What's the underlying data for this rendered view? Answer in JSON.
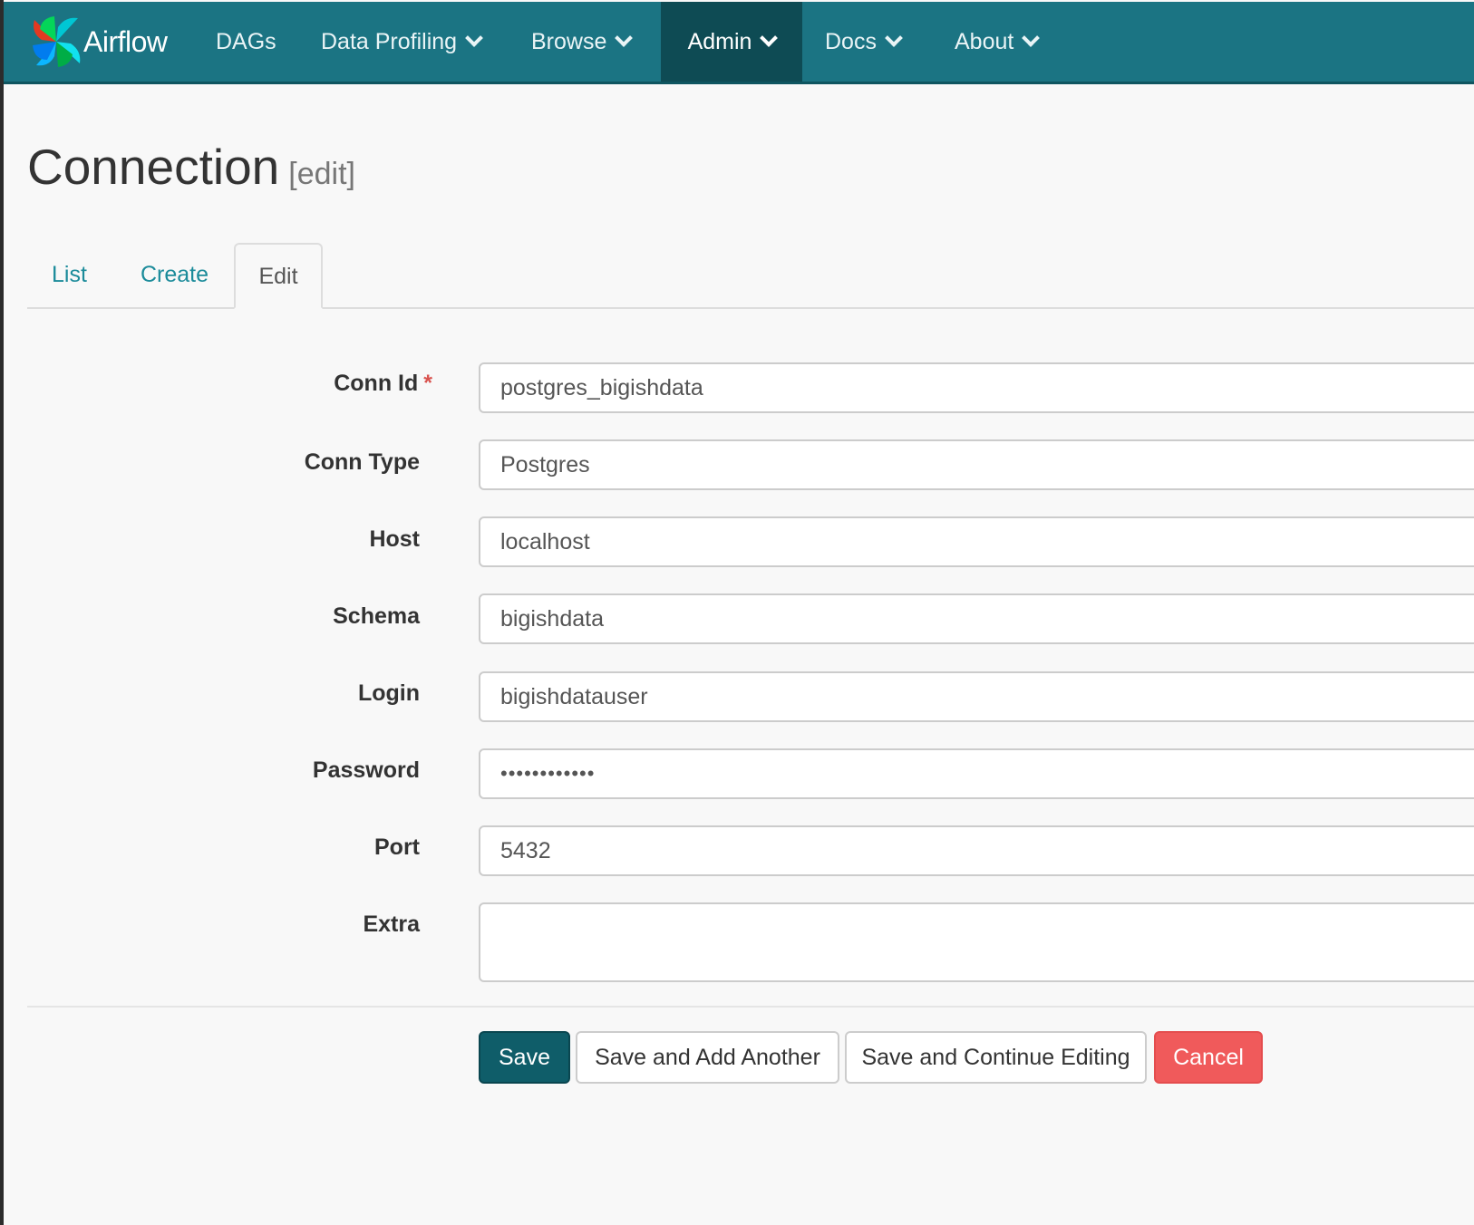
{
  "navbar": {
    "brand": "Airflow",
    "items": [
      {
        "label": "DAGs",
        "dropdown": false
      },
      {
        "label": "Data Profiling",
        "dropdown": true
      },
      {
        "label": "Browse",
        "dropdown": true
      },
      {
        "label": "Admin",
        "dropdown": true,
        "active": true
      },
      {
        "label": "Docs",
        "dropdown": true
      },
      {
        "label": "About",
        "dropdown": true
      }
    ]
  },
  "page": {
    "title": "Connection",
    "subtitle": "[edit]"
  },
  "tabs": [
    {
      "label": "List"
    },
    {
      "label": "Create"
    },
    {
      "label": "Edit",
      "active": true
    }
  ],
  "form": {
    "fields": [
      {
        "label": "Conn Id",
        "required": true,
        "required_mark": "*",
        "value": "postgres_bigishdata"
      },
      {
        "label": "Conn Type",
        "value": "Postgres"
      },
      {
        "label": "Host",
        "value": "localhost"
      },
      {
        "label": "Schema",
        "value": "bigishdata"
      },
      {
        "label": "Login",
        "value": "bigishdatauser"
      },
      {
        "label": "Password",
        "value": "••••••••••••"
      },
      {
        "label": "Port",
        "value": "5432"
      },
      {
        "label": "Extra",
        "value": ""
      }
    ]
  },
  "actions": {
    "save": "Save",
    "save_add": "Save and Add Another",
    "save_continue": "Save and Continue Editing",
    "cancel": "Cancel"
  },
  "colors": {
    "navbar": "#1b7483",
    "navbar_active": "#0e4b54",
    "link": "#1b8b9a",
    "save_button": "#0f5d69",
    "cancel_button": "#f05a5b"
  }
}
